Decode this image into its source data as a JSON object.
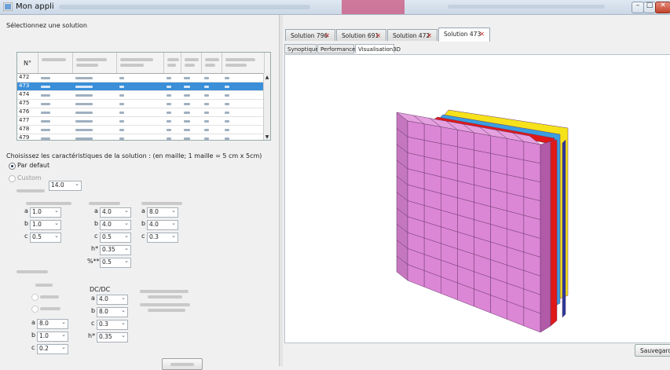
{
  "window": {
    "title": "Mon appli"
  },
  "left": {
    "select_label": "Sélectionnez une solution",
    "table": {
      "header_first": "N°",
      "rows": [
        {
          "num": "472",
          "selected": false
        },
        {
          "num": "473",
          "selected": true
        },
        {
          "num": "474",
          "selected": false
        },
        {
          "num": "475",
          "selected": false
        },
        {
          "num": "476",
          "selected": false
        },
        {
          "num": "477",
          "selected": false
        },
        {
          "num": "478",
          "selected": false
        },
        {
          "num": "479",
          "selected": false
        }
      ]
    },
    "characteristics_label": "Choisissez les caractéristiques de la solution :  (en maille; 1 maille = 5 cm x 5cm)",
    "radio_default": "Par defaut",
    "radio_custom": "Custom",
    "main_combo": "14.0",
    "col1": {
      "a": "1.0",
      "b": "1.0",
      "c": "0.5"
    },
    "col2": {
      "a": "4.0",
      "b": "4.0",
      "c": "0.5",
      "h": "0.35",
      "pct": "0.5",
      "h_label": "h*",
      "pct_label": "%**"
    },
    "col3": {
      "a": "8.0",
      "b": "4.0",
      "c": "0.3"
    },
    "lower": {
      "dcdc_label": "DC/DC",
      "dcdc": {
        "a": "4.0",
        "b": "8.0",
        "c": "0.3",
        "h": "0.35",
        "h_label": "h*"
      },
      "left": {
        "a": "8.0",
        "b": "1.0",
        "c": "0.2"
      }
    },
    "letters": {
      "a": "a",
      "b": "b",
      "c": "c"
    }
  },
  "right": {
    "tabs": [
      {
        "label": "Solution 796",
        "close": "✕"
      },
      {
        "label": "Solution 691",
        "close": "✕"
      },
      {
        "label": "Solution 472",
        "close": "✕"
      },
      {
        "label": "Solution 473",
        "close": "✕"
      }
    ],
    "subtabs": [
      "Synoptique",
      "Performances",
      "Visualisation3D"
    ],
    "save_label": "Sauvegarder"
  },
  "colors": {
    "pink": "#dc86d6",
    "red": "#e01818",
    "blue": "#3a9ee0",
    "yellow": "#f6e21a",
    "navy": "#2a3a9a",
    "selection": "#3a8fd8"
  }
}
